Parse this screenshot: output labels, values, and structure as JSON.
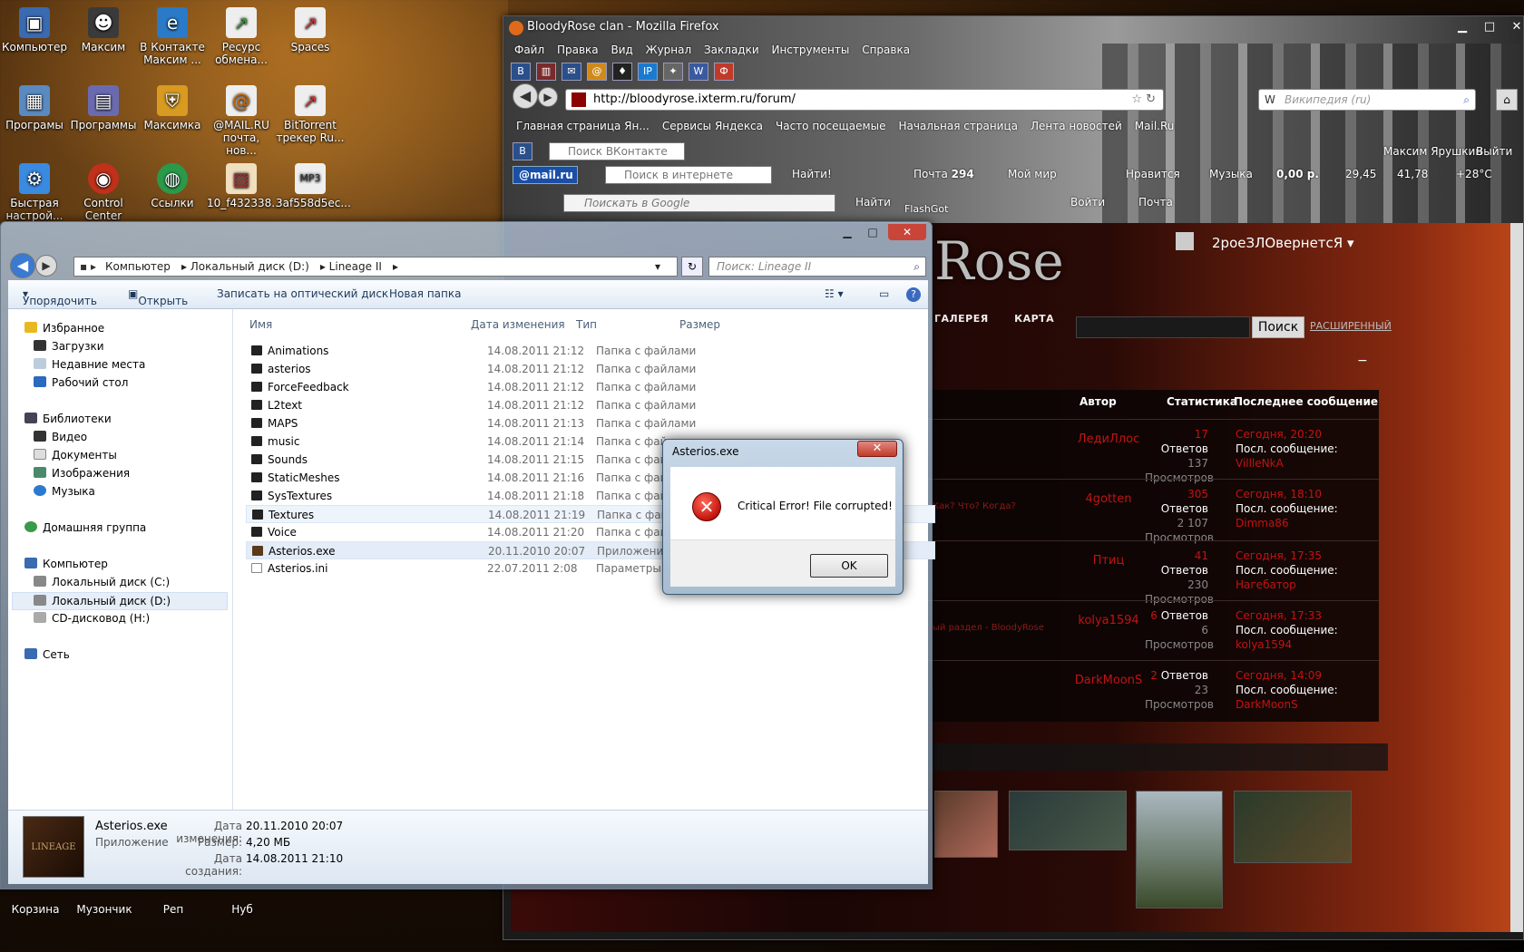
{
  "desktop": {
    "icons": [
      {
        "label": "Компьютер"
      },
      {
        "label": "Максим"
      },
      {
        "label": "В Контакте Максим ..."
      },
      {
        "label": "Ресурс обмена..."
      },
      {
        "label": "Spaces"
      },
      {
        "label": "Програмы"
      },
      {
        "label": "Программы"
      },
      {
        "label": "Максимка"
      },
      {
        "label": "@MAIL.RU почта, нов..."
      },
      {
        "label": "BitTorrent трекер Ru..."
      },
      {
        "label": "Быстрая настрой..."
      },
      {
        "label": "Control Center"
      },
      {
        "label": "Ссылки"
      },
      {
        "label": "10_f432338..."
      },
      {
        "label": "3af558d5ec..."
      }
    ],
    "bottom_icons": [
      {
        "label": "Корзина"
      },
      {
        "label": "Музончик"
      },
      {
        "label": "Реп"
      },
      {
        "label": "Нуб"
      }
    ]
  },
  "firefox": {
    "title": "BloodyRose clan - Mozilla Firefox",
    "menu": [
      "Файл",
      "Правка",
      "Вид",
      "Журнал",
      "Закладки",
      "Инструменты",
      "Справка"
    ],
    "url": "http://bloodyrose.ixterm.ru/forum/",
    "search_placeholder": "Википедия (ru)",
    "bookmarks": [
      "Главная страница Ян...",
      "Сервисы Яндекса",
      "Часто посещаемые",
      "Начальная страница",
      "Лента новостей",
      "Mail.Ru"
    ],
    "vk_search_placeholder": "Поиск ВКонтакте",
    "vk_user": "Максим Ярушкин",
    "vk_exit": "Выйти",
    "mailru_logo": "@mail.ru",
    "mailru_search_placeholder": "Поиск в интернете",
    "find_label": "Найти!",
    "mail_label": "Почта",
    "mail_count": "294",
    "mymir_label": "Мой мир",
    "likes_label": "Нравится",
    "music_label": "Музыка",
    "money_label": "0,00 р.",
    "rate1": "29,45",
    "rate2": "41,78",
    "weather": "+28°C",
    "google_placeholder": "Поискать в Google",
    "google_find": "Найти",
    "flashgot": "FlashGot",
    "signin": "Войти",
    "mail_short": "Почта"
  },
  "forum": {
    "logo": "Rose",
    "user": "2роеЗЛОвернетсЯ",
    "nav": [
      "ГАЛЕРЕЯ",
      "КАРТА"
    ],
    "search_button": "Поиск",
    "advanced": "РАСШИРЕННЫЙ",
    "headers": {
      "author": "Автор",
      "stats": "Статистика",
      "last": "Последнее сообщение"
    },
    "rows": [
      {
        "topic": "",
        "author": "ЛедиЛлос",
        "replies": "17",
        "replies_label": "Ответов",
        "views": "137",
        "views_label": "Просмотров",
        "when": "Сегодня, 20:20",
        "last_label": "Посл. сообщение:",
        "last_user": "VillleNkA"
      },
      {
        "topic": "Как? Что? Когда?",
        "author": "4gotten",
        "replies": "305",
        "replies_label": "Ответов",
        "views": "2 107",
        "views_label": "Просмотров",
        "when": "Сегодня, 18:10",
        "last_label": "Посл. сообщение:",
        "last_user": "Dimma86"
      },
      {
        "topic": "",
        "author": "Птиц",
        "replies": "41",
        "replies_label": "Ответов",
        "views": "230",
        "views_label": "Просмотров",
        "when": "Сегодня, 17:35",
        "last_label": "Посл. сообщение:",
        "last_user": "Нагебатор"
      },
      {
        "topic": "ый раздел - BloodyRose",
        "author": "kolya1594",
        "replies": "6",
        "replies_label": "Ответов",
        "views": "6",
        "views_label": "Просмотров",
        "when": "Сегодня, 17:33",
        "last_label": "Посл. сообщение:",
        "last_user": "kolya1594"
      },
      {
        "topic": "",
        "author": "DarkMoonS",
        "replies": "2",
        "replies_label": "Ответов",
        "views": "23",
        "views_label": "Просмотров",
        "when": "Сегодня, 14:09",
        "last_label": "Посл. сообщение:",
        "last_user": "DarkMoonS"
      }
    ]
  },
  "explorer": {
    "breadcrumb": [
      "Компьютер",
      "Локальный диск (D:)",
      "Lineage II"
    ],
    "search_placeholder": "Поиск: Lineage II",
    "toolbar": {
      "organize": "Упорядочить",
      "open": "Открыть",
      "burn": "Записать на оптический диск",
      "new_folder": "Новая папка"
    },
    "nav": {
      "favorites": "Избранное",
      "downloads": "Загрузки",
      "recent": "Недавние места",
      "desktop": "Рабочий стол",
      "libraries": "Библиотеки",
      "video": "Видео",
      "documents": "Документы",
      "images": "Изображения",
      "music": "Музыка",
      "homegroup": "Домашняя группа",
      "computer": "Компьютер",
      "disk_c": "Локальный диск (C:)",
      "disk_d": "Локальный диск (D:)",
      "cd": "CD-дисковод (H:)",
      "network": "Сеть"
    },
    "columns": {
      "name": "Имя",
      "date": "Дата изменения",
      "type": "Тип",
      "size": "Размер"
    },
    "files": [
      {
        "name": "Animations",
        "date": "14.08.2011 21:12",
        "type": "Папка с файлами"
      },
      {
        "name": "asterios",
        "date": "14.08.2011 21:12",
        "type": "Папка с файлами"
      },
      {
        "name": "ForceFeedback",
        "date": "14.08.2011 21:12",
        "type": "Папка с файлами"
      },
      {
        "name": "L2text",
        "date": "14.08.2011 21:12",
        "type": "Папка с файлами"
      },
      {
        "name": "MAPS",
        "date": "14.08.2011 21:13",
        "type": "Папка с файлами"
      },
      {
        "name": "music",
        "date": "14.08.2011 21:14",
        "type": "Папка с файла"
      },
      {
        "name": "Sounds",
        "date": "14.08.2011 21:15",
        "type": "Папка с файла"
      },
      {
        "name": "StaticMeshes",
        "date": "14.08.2011 21:16",
        "type": "Папка с файла"
      },
      {
        "name": "SysTextures",
        "date": "14.08.2011 21:18",
        "type": "Папка с файла"
      },
      {
        "name": "Textures",
        "date": "14.08.2011 21:19",
        "type": "Папка с файла"
      },
      {
        "name": "Voice",
        "date": "14.08.2011 21:20",
        "type": "Папка с файла"
      },
      {
        "name": "Asterios.exe",
        "date": "20.11.2010 20:07",
        "type": "Приложение"
      },
      {
        "name": "Asterios.ini",
        "date": "22.07.2011 2:08",
        "type": "Параметры ко"
      }
    ],
    "details": {
      "name": "Asterios.exe",
      "kind": "Приложение",
      "modified_label": "Дата изменения:",
      "modified": "20.11.2010 20:07",
      "size_label": "Размер:",
      "size": "4,20 МБ",
      "created_label": "Дата создания:",
      "created": "14.08.2011 21:10",
      "thumb_text": "LINEAGE"
    }
  },
  "dialog": {
    "title": "Asterios.exe",
    "message": "Critical Error! File corrupted!",
    "ok": "OK"
  }
}
